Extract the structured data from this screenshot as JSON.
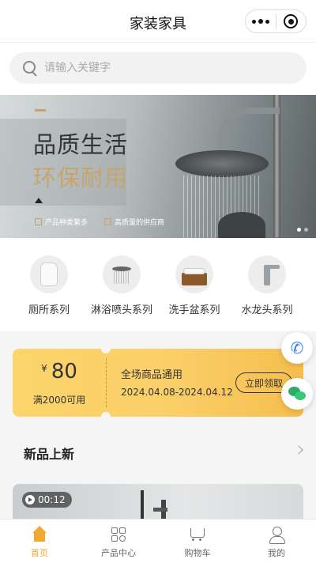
{
  "header": {
    "title": "家装家具"
  },
  "search": {
    "placeholder": "请输入关键字"
  },
  "banner": {
    "line1": "品质生活",
    "line2": "环保耐用",
    "features": [
      "产品种类繁多",
      "高质量的供应商"
    ],
    "slide_count": 2,
    "active_slide": 1
  },
  "categories": [
    {
      "label": "厕所系列",
      "icon": "toilet-icon"
    },
    {
      "label": "淋浴喷头系列",
      "icon": "shower-icon"
    },
    {
      "label": "洗手盆系列",
      "icon": "basin-icon"
    },
    {
      "label": "水龙头系列",
      "icon": "faucet-icon"
    }
  ],
  "coupon": {
    "currency": "¥",
    "amount": "80",
    "condition": "满2000可用",
    "scope": "全场商品通用",
    "dates": "2024.04.08-2024.04.12",
    "action": "立即领取"
  },
  "section": {
    "title": "新品上新"
  },
  "video": {
    "duration": "00:12"
  },
  "tabbar": [
    {
      "label": "首页",
      "icon": "home-icon",
      "active": true
    },
    {
      "label": "产品中心",
      "icon": "grid-icon",
      "active": false
    },
    {
      "label": "购物车",
      "icon": "cart-icon",
      "active": false
    },
    {
      "label": "我的",
      "icon": "user-icon",
      "active": false
    }
  ],
  "colors": {
    "accent": "#f0a92e",
    "coupon": "#fbd46b",
    "gold": "#c9a46a"
  }
}
